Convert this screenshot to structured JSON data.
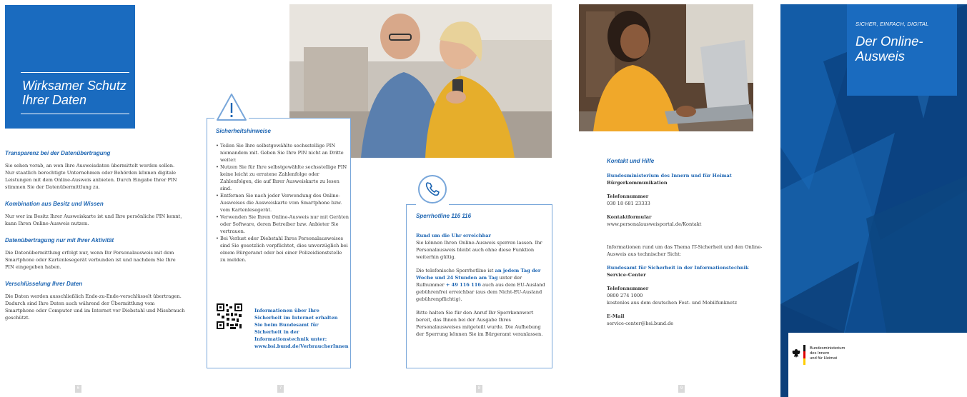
{
  "panel1": {
    "title": "Wirksamer Schutz Ihrer Daten",
    "sections": [
      {
        "heading": "Transparenz bei der Datenübertragung",
        "text": "Sie sehen vorab, an wen Ihre Ausweisdaten übermittelt werden sollen. Nur staatlich berechtigte Unternehmen oder Behörden können digitale Leistungen mit dem Online-Ausweis anbieten. Durch Eingabe Ihrer PIN stimmen Sie der Datenübermittlung zu."
      },
      {
        "heading": "Kombination aus Besitz und Wissen",
        "text": "Nur wer im Besitz Ihrer Ausweiskarte ist und Ihre persönliche PIN kennt, kann Ihren Online-Ausweis nutzen."
      },
      {
        "heading": "Datenübertragung nur mit Ihrer Aktivität",
        "text": "Die Datenübermittlung erfolgt nur, wenn Ihr Personalausweis mit dem Smartphone oder Kartenlesegerät verbunden ist und nachdem Sie Ihre PIN eingegeben haben."
      },
      {
        "heading": "Verschlüsselung Ihrer Daten",
        "text": "Die Daten werden ausschließlich Ende-zu-Ende-verschlüsselt übertragen. Dadurch sind Ihre Daten auch während der Übermittlung vom Smartphone oder Computer und im Internet vor Diebstahl und Missbrauch geschützt."
      }
    ],
    "page_number": "6"
  },
  "panel2": {
    "heading": "Sicherheitshinweise",
    "bullets": [
      "Teilen Sie Ihre selbstgewählte sechsstellige PIN niemandem mit. Geben Sie Ihre PIN nicht an Dritte weiter.",
      "Nutzen Sie für Ihre selbstgewählte sechsstellige PIN keine leicht zu erratene Zahlenfolge oder Zahlenfolgen, die auf Ihrer Ausweiskarte zu lesen sind.",
      "Entfernen Sie nach jeder Verwendung des Online-Ausweises die Ausweiskarte vom Smartphone bzw. vom Kartenlesegerät.",
      "Verwenden Sie Ihren Online-Ausweis nur mit Geräten oder Software, deren Betreiber bzw. Anbieter Sie vertrauen.",
      "Bei Verlust oder Diebstahl Ihres Personalausweises sind Sie gesetzlich verpflichtet, dies unverzüglich bei einem Bürgeramt oder bei einer Polizeidienststelle zu melden."
    ],
    "qr_text": "Informationen über Ihre Sicherheit im Internet erhalten Sie beim Bundesamt für Sicherheit in der Informationstechnik unter: www.bsi.bund.de/VerbraucherInnen",
    "page_number": "7"
  },
  "panel3": {
    "heading": "Sperrhotline 116 116",
    "subheading": "Rund um die Uhr erreichbar",
    "p1": "Sie können Ihren Online-Ausweis sperren lassen. Ihr Personalausweis bleibt auch ohne diese Funktion weiterhin gültig.",
    "p2_a": "Die telefonische Sperrhotline ist ",
    "p2_b": "an jedem Tag der Woche und 24 Stunden am Tag",
    "p2_c": " unter der Rufnummer ",
    "p2_d": "+ 49 116 116",
    "p2_e": " auch aus dem EU-Ausland gebührenfrei erreichbar (aus dem Nicht-EU-Ausland gebührenpflichtig).",
    "p3": "Bitte halten Sie für den Anruf Ihr Sperrkennwort bereit, das Ihnen bei der Ausgabe Ihres Personalausweises mitgeteilt wurde. Die Aufhebung der Sperrung können Sie im Bürgeramt veranlassen.",
    "page_number": "8"
  },
  "panel4": {
    "heading": "Kontakt und Hilfe",
    "org1": "Bundesministerium des Innern und für Heimat",
    "org1_sub": "Bürgerkommunikation",
    "tel_label": "Telefonnummer",
    "tel1": "030 18 681 23333",
    "form_label": "Kontaktformular",
    "form_url": "www.personalausweisportal.de/Kontakt",
    "info": "Informationen rund um das Thema IT-Sicherheit und den Online-Ausweis aus technischer Sicht:",
    "org2": "Bundesamt für Sicherheit in der Informationstechnik",
    "org2_sub": "Service-Center",
    "tel2_label": "Telefonnummer",
    "tel2": "0800 274 1000",
    "tel2_note": "kostenlos aus dem deutschen Fest- und Mobilfunknetz",
    "mail_label": "E-Mail",
    "mail": "service-center@bsi.bund.de",
    "page_number": "9"
  },
  "panel5": {
    "kicker": "SICHER, EINFACH, DIGITAL",
    "title": "Der Online-Ausweis",
    "logo_line1": "Bundesministerium",
    "logo_line2": "des Innern",
    "logo_line3": "und für Heimat"
  },
  "colors": {
    "brand_blue": "#1a6bbf",
    "dark_blue": "#0e4c8f",
    "light_border": "#79a7da"
  }
}
